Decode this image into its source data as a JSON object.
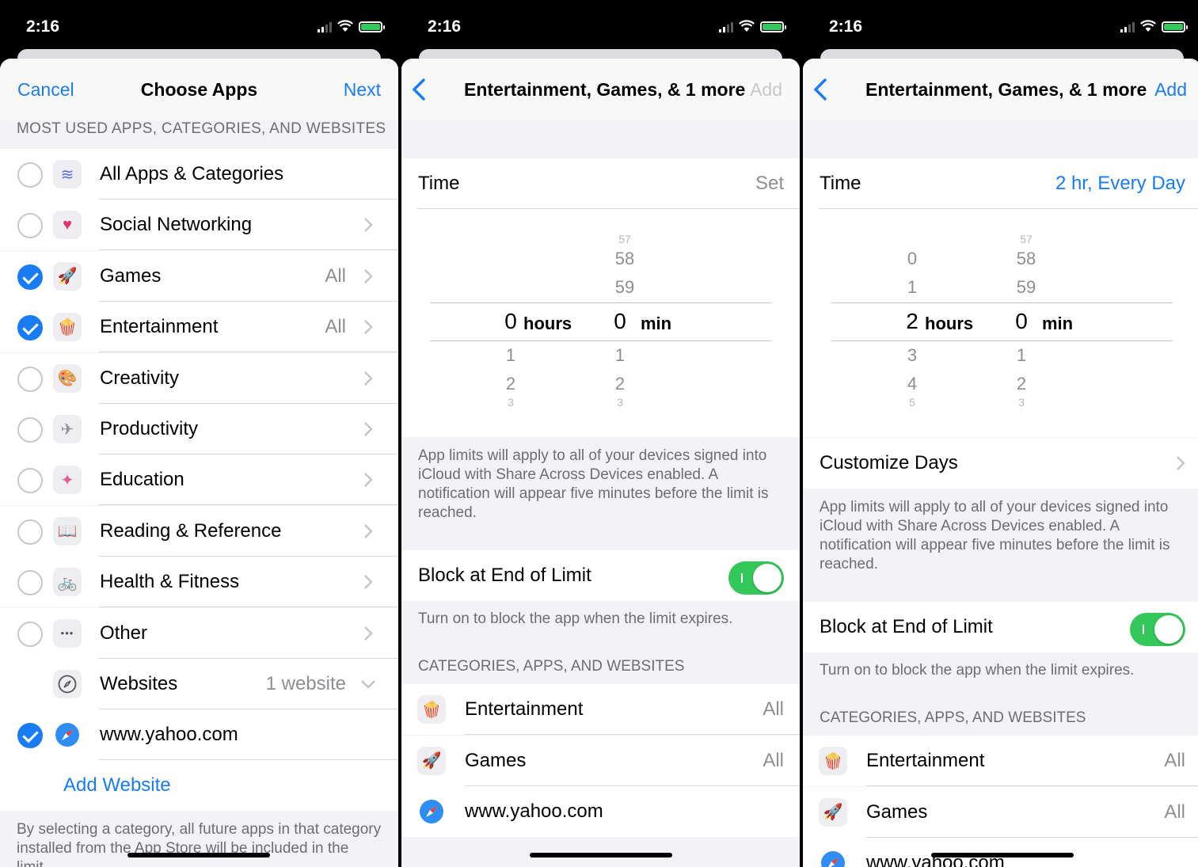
{
  "status": {
    "time": "2:16"
  },
  "screen1": {
    "nav": {
      "cancel": "Cancel",
      "title": "Choose Apps",
      "next": "Next"
    },
    "section_header": "MOST USED APPS, CATEGORIES, AND WEBSITES",
    "items": [
      {
        "label": "All Apps & Categories",
        "detail": "",
        "checked": false,
        "icon": "stack-icon",
        "glyph": "≋",
        "color": "#5b6ee1",
        "chevron": false
      },
      {
        "label": "Social Networking",
        "detail": "",
        "checked": false,
        "icon": "chat-heart-icon",
        "glyph": "♥",
        "color": "#e0356c",
        "chevron": true
      },
      {
        "label": "Games",
        "detail": "All",
        "checked": true,
        "icon": "rocket-icon",
        "glyph": "🚀",
        "color": "#4a90e2",
        "chevron": true
      },
      {
        "label": "Entertainment",
        "detail": "All",
        "checked": true,
        "icon": "popcorn-icon",
        "glyph": "🍿",
        "color": "#e0352b",
        "chevron": true
      },
      {
        "label": "Creativity",
        "detail": "",
        "checked": false,
        "icon": "palette-icon",
        "glyph": "🎨",
        "color": "#f0a030",
        "chevron": true
      },
      {
        "label": "Productivity",
        "detail": "",
        "checked": false,
        "icon": "paper-plane-icon",
        "glyph": "✈",
        "color": "#8e8e93",
        "chevron": true
      },
      {
        "label": "Education",
        "detail": "",
        "checked": false,
        "icon": "education-icon",
        "glyph": "✦",
        "color": "#e65a8c",
        "chevron": true
      },
      {
        "label": "Reading & Reference",
        "detail": "",
        "checked": false,
        "icon": "book-icon",
        "glyph": "📖",
        "color": "#5b8ed6",
        "chevron": true
      },
      {
        "label": "Health & Fitness",
        "detail": "",
        "checked": false,
        "icon": "bicycle-icon",
        "glyph": "🚲",
        "color": "#4a90e2",
        "chevron": true
      },
      {
        "label": "Other",
        "detail": "",
        "checked": false,
        "icon": "ellipsis-icon",
        "glyph": "•••",
        "color": "#555",
        "chevron": true
      }
    ],
    "websites": {
      "label": "Websites",
      "detail": "1 website"
    },
    "website_item": {
      "label": "www.yahoo.com",
      "checked": true
    },
    "add_website": "Add Website",
    "footer": "By selecting a category, all future apps in that category installed from the App Store will be included in the limit."
  },
  "screen2": {
    "nav": {
      "title": "Entertainment, Games, & 1 more",
      "add": "Add"
    },
    "time_label": "Time",
    "time_value": "Set",
    "picker": {
      "hours_before": [
        "",
        ""
      ],
      "hours_selected": "0",
      "hours_after": [
        "1",
        "2",
        "3"
      ],
      "hours_label": "hours",
      "min_before": [
        "57",
        "58",
        "59"
      ],
      "min_selected": "0",
      "min_after": [
        "1",
        "2",
        "3"
      ],
      "min_label": "min"
    },
    "info": "App limits will apply to all of your devices signed into iCloud with Share Across Devices enabled. A notification will appear five minutes before the limit is reached.",
    "block_label": "Block at End of Limit",
    "block_on": true,
    "block_footer": "Turn on to block the app when the limit expires.",
    "list_header": "CATEGORIES, APPS, AND WEBSITES",
    "list": [
      {
        "label": "Entertainment",
        "detail": "All"
      },
      {
        "label": "Games",
        "detail": "All"
      },
      {
        "label": "www.yahoo.com",
        "detail": ""
      }
    ]
  },
  "screen3": {
    "nav": {
      "title": "Entertainment, Games, & 1 more",
      "add": "Add"
    },
    "time_label": "Time",
    "time_value": "2 hr, Every Day",
    "picker": {
      "hours_before": [
        "0",
        "1"
      ],
      "hours_selected": "2",
      "hours_after": [
        "3",
        "4",
        "5"
      ],
      "hours_label": "hours",
      "min_before": [
        "57",
        "58",
        "59"
      ],
      "min_selected": "0",
      "min_after": [
        "1",
        "2",
        "3"
      ],
      "min_label": "min"
    },
    "customize_days": "Customize Days",
    "info": "App limits will apply to all of your devices signed into iCloud with Share Across Devices enabled. A notification will appear five minutes before the limit is reached.",
    "block_label": "Block at End of Limit",
    "block_on": true,
    "block_footer": "Turn on to block the app when the limit expires.",
    "list_header": "CATEGORIES, APPS, AND WEBSITES",
    "list": [
      {
        "label": "Entertainment",
        "detail": "All"
      },
      {
        "label": "Games",
        "detail": "All"
      },
      {
        "label": "www.yahoo.com",
        "detail": ""
      }
    ]
  },
  "colors": {
    "accent": "#1a7cf5",
    "switch_on": "#34c759",
    "background": "#f2f2f7",
    "secondary_text": "#8e8e93"
  }
}
